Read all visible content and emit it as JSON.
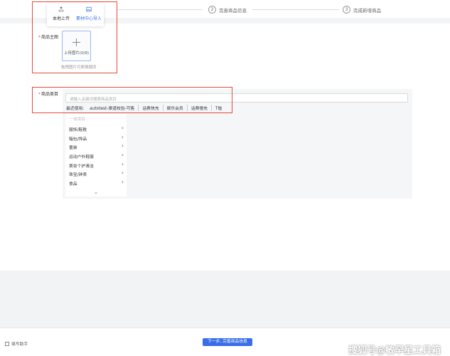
{
  "steps": [
    {
      "num": "2",
      "label": "完善商品信息"
    },
    {
      "num": "3",
      "label": "完成新增商品"
    }
  ],
  "upload_popover": {
    "local_label": "本地上传",
    "material_label": "素材中心导入"
  },
  "main_image": {
    "label": "商品主图",
    "upload_label": "上传图片(0/9)",
    "hint": "拖拽图片可更换顺序"
  },
  "category": {
    "label": "商品类目",
    "search_placeholder": "请输入关键词搜索商品类目",
    "recent_label": "最近使用:",
    "recent": [
      "autotest-渠道校验-可售",
      "话费快充",
      "娱乐会员",
      "话费慢充",
      "T恤"
    ],
    "level_title": "一级类目",
    "items": [
      "服饰/鞋靴",
      "箱包/饰品",
      "童装",
      "运动户外鞋服",
      "美妆个护清洁",
      "珠宝/钟表",
      "食品"
    ]
  },
  "footer": {
    "helper_label": "填写助手",
    "next_label": "下一步, 完善商品信息"
  },
  "watermark": "搜狐号@敏罕星工具箱",
  "colors": {
    "accent": "#3a6ee8",
    "highlight_border": "#e14c3c"
  }
}
